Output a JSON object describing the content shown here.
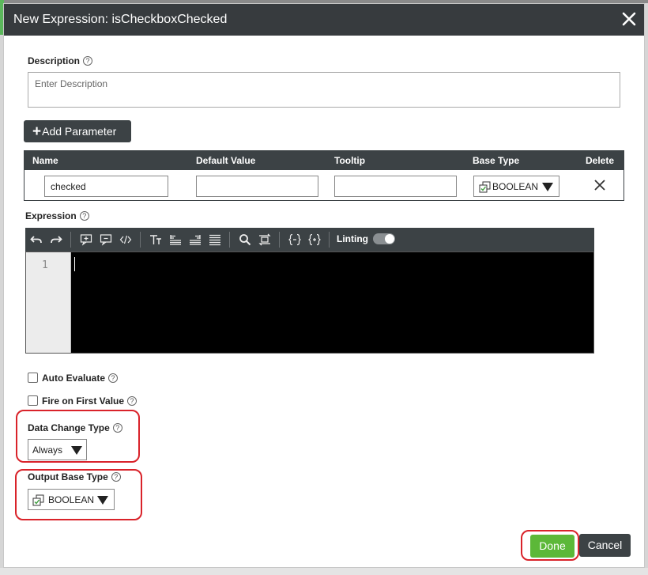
{
  "dialog": {
    "title": "New Expression: isCheckboxChecked",
    "close_icon": "close-icon"
  },
  "description": {
    "label": "Description",
    "placeholder": "Enter Description",
    "value": ""
  },
  "add_parameter": {
    "label": "Add Parameter",
    "icon": "plus-icon"
  },
  "parameters": {
    "headers": {
      "name": "Name",
      "default_value": "Default Value",
      "tooltip": "Tooltip",
      "base_type": "Base Type",
      "delete": "Delete"
    },
    "rows": [
      {
        "name": "checked",
        "default_value": "",
        "tooltip": "",
        "base_type": "BOOLEAN"
      }
    ]
  },
  "expression": {
    "label": "Expression",
    "toolbar": {
      "icons": [
        "undo-icon",
        "redo-icon",
        "add-comment-icon",
        "remove-comment-icon",
        "code-tag-icon",
        "text-size-icon",
        "align-left-icon",
        "align-right-icon",
        "justify-icon",
        "search-icon",
        "replace-icon",
        "fold-icon",
        "unfold-icon"
      ],
      "linting_label": "Linting",
      "linting_on": true
    },
    "line_numbers": [
      "1"
    ],
    "code": ""
  },
  "options": {
    "auto_evaluate": {
      "label": "Auto Evaluate",
      "checked": false
    },
    "fire_on_first_value": {
      "label": "Fire on First Value",
      "checked": false
    }
  },
  "data_change_type": {
    "label": "Data Change Type",
    "value": "Always"
  },
  "output_base_type": {
    "label": "Output Base Type",
    "value": "BOOLEAN"
  },
  "footer": {
    "done_label": "Done",
    "cancel_label": "Cancel"
  },
  "colors": {
    "done": "#5cb838",
    "toolbar": "#3c4245",
    "highlight": "#d9232a",
    "title_bar": "#373b3e"
  }
}
